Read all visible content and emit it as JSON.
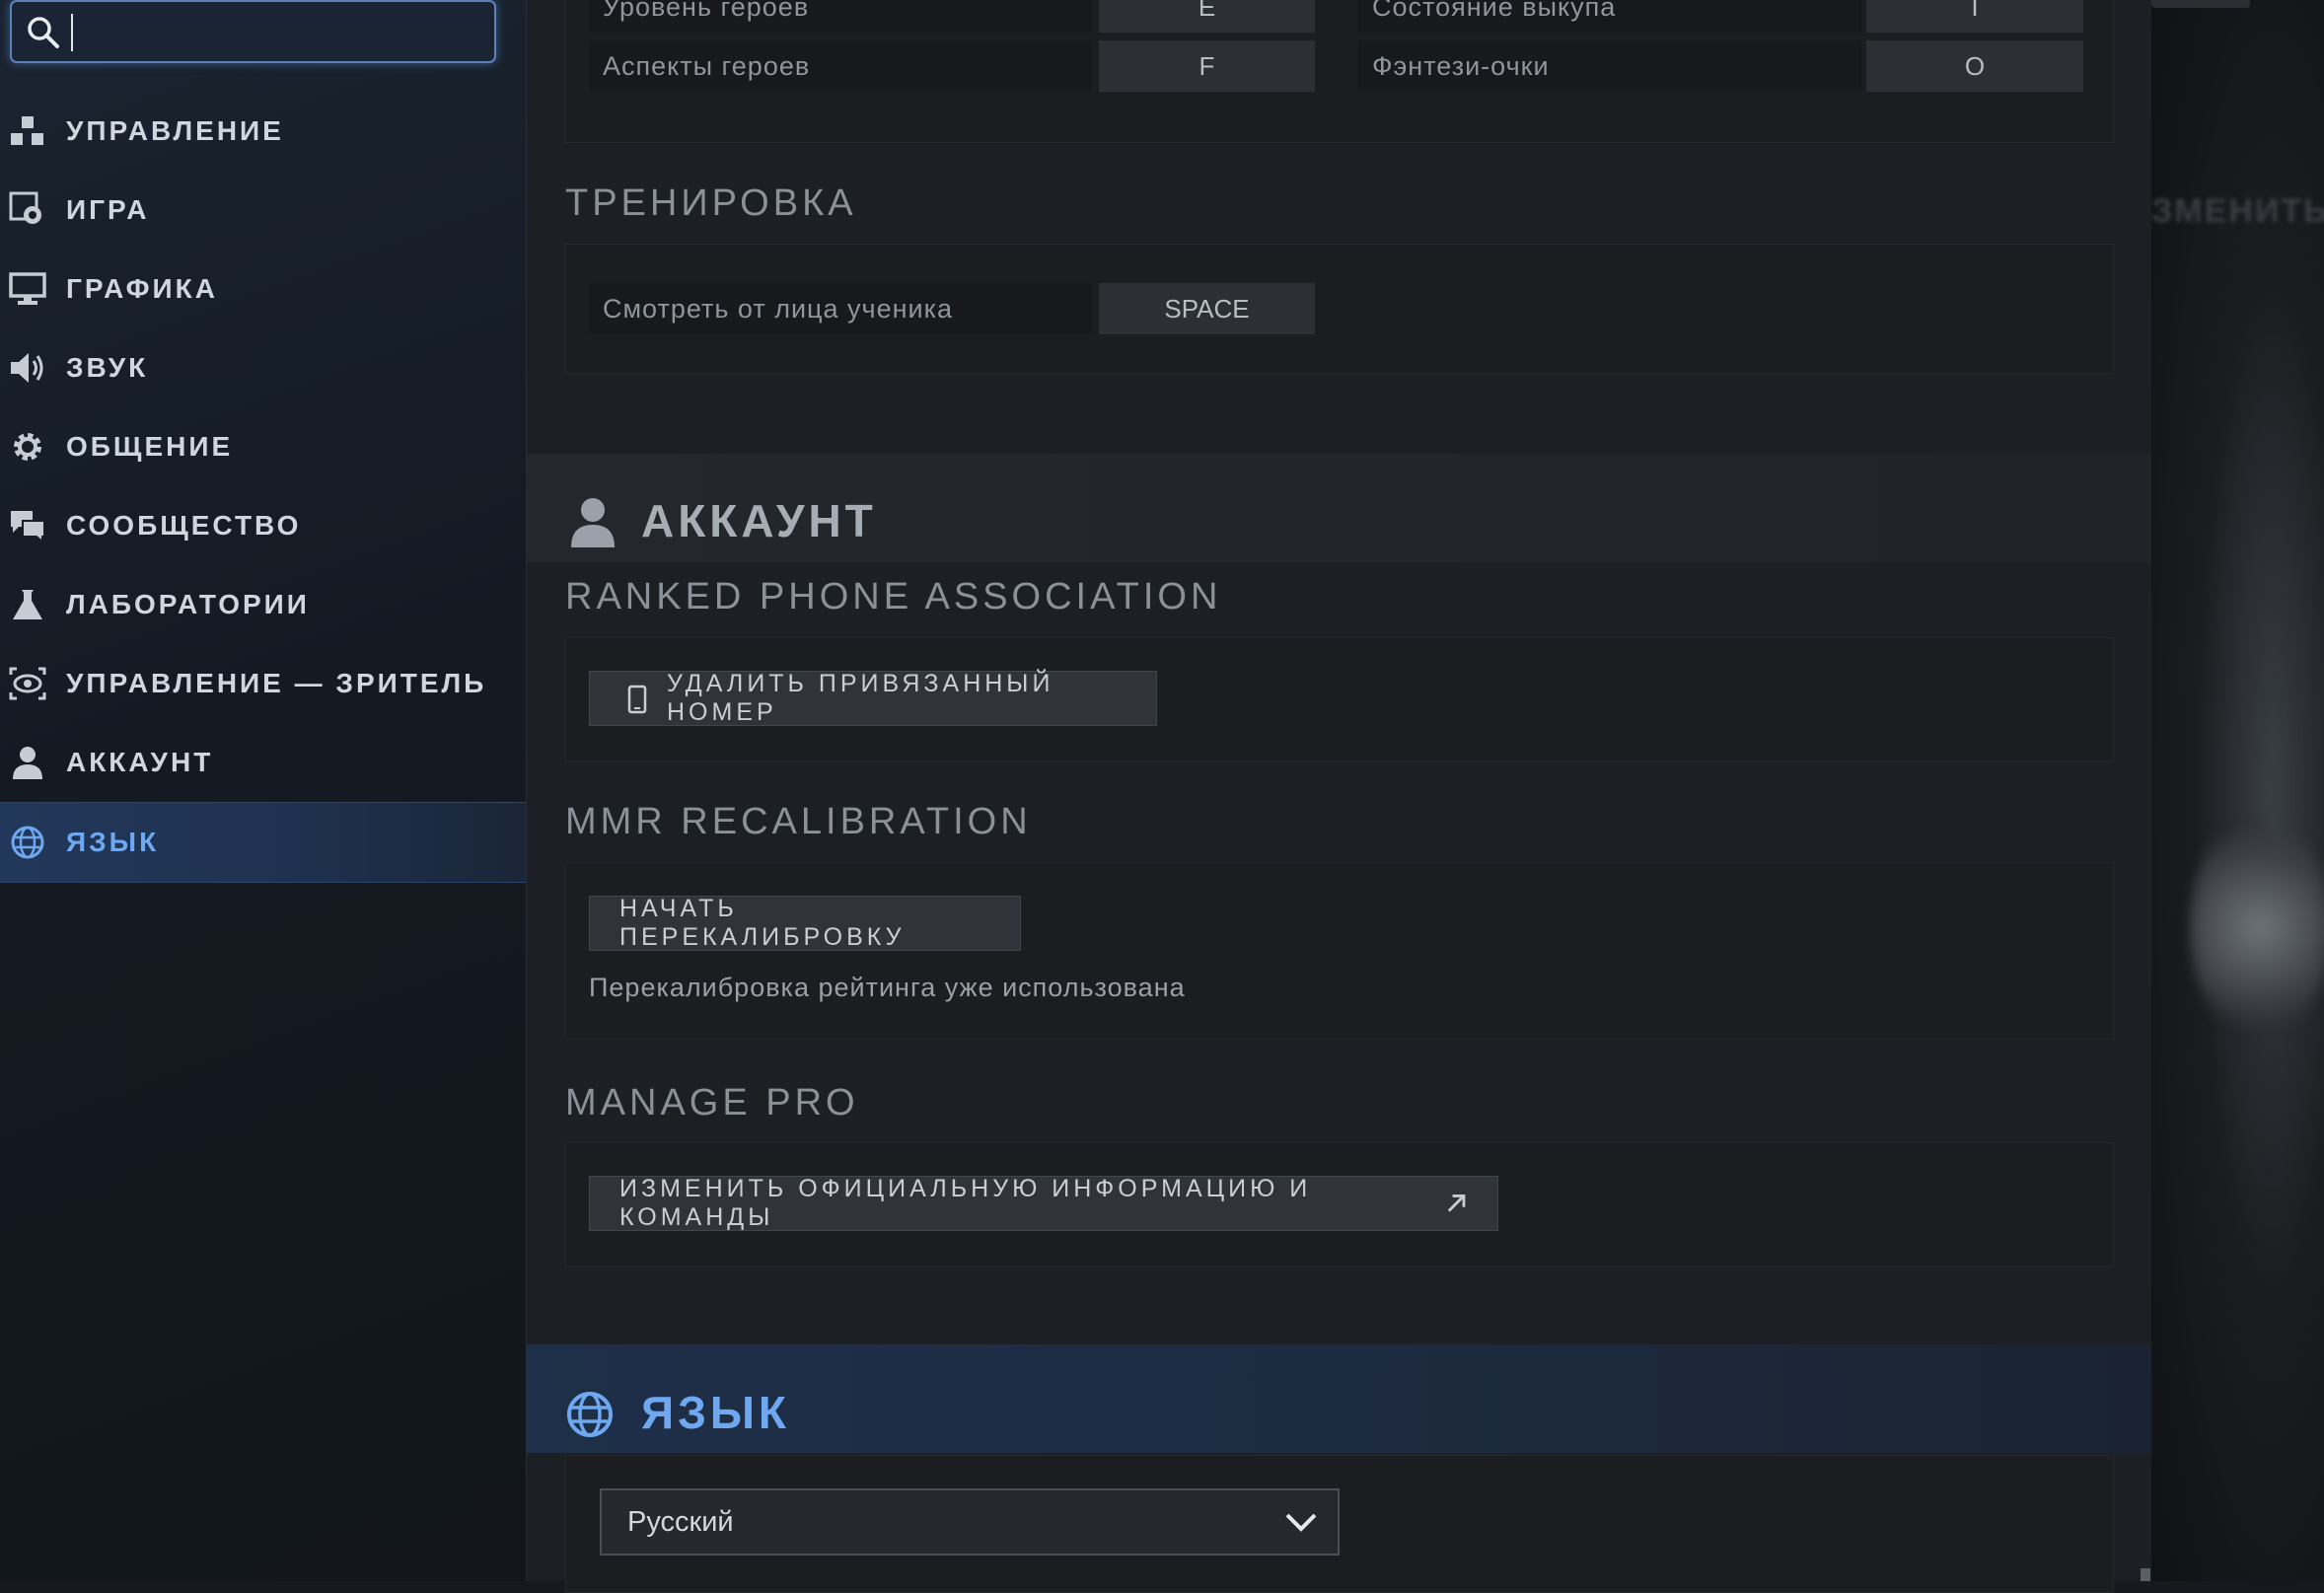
{
  "search": {
    "value": "",
    "placeholder": ""
  },
  "sidebar": {
    "items": [
      {
        "label": "УПРАВЛЕНИЕ",
        "icon": "controls-icon",
        "active": false
      },
      {
        "label": "ИГРА",
        "icon": "game-settings-icon",
        "active": false
      },
      {
        "label": "ГРАФИКА",
        "icon": "monitor-icon",
        "active": false
      },
      {
        "label": "ЗВУК",
        "icon": "speaker-icon",
        "active": false
      },
      {
        "label": "ОБЩЕНИЕ",
        "icon": "gear-icon",
        "active": false
      },
      {
        "label": "СООБЩЕСТВО",
        "icon": "chat-bubbles-icon",
        "active": false
      },
      {
        "label": "ЛАБОРАТОРИИ",
        "icon": "flask-icon",
        "active": false
      },
      {
        "label": "УПРАВЛЕНИЕ — ЗРИТЕЛЬ",
        "icon": "eye-icon",
        "active": false
      },
      {
        "label": "АККАУНТ",
        "icon": "user-icon",
        "active": false
      },
      {
        "label": "ЯЗЫК",
        "icon": "globe-icon",
        "active": true
      }
    ]
  },
  "hotkeys": {
    "rows": [
      {
        "left_label": "Уровень героев",
        "left_key": "E",
        "right_label": "Состояние выкупа",
        "right_key": "I"
      },
      {
        "left_label": "Аспекты героев",
        "left_key": "F",
        "right_label": "Фэнтези-очки",
        "right_key": "O"
      }
    ]
  },
  "training": {
    "title": "ТРЕНИРОВКА",
    "row_label": "Смотреть от лица ученика",
    "row_key": "SPACE"
  },
  "account": {
    "title": "АККАУНТ",
    "phone": {
      "title": "RANKED PHONE ASSOCIATION",
      "button": "УДАЛИТЬ ПРИВЯЗАННЫЙ НОМЕР"
    },
    "mmr": {
      "title": "MMR RECALIBRATION",
      "button": "НАЧАТЬ ПЕРЕКАЛИБРОВКУ",
      "note": "Перекалибровка рейтинга уже использована"
    },
    "pro": {
      "title": "MANAGE PRO",
      "button": "ИЗМЕНИТЬ ОФИЦИАЛЬНУЮ ИНФОРМАЦИЮ И КОМАНДЫ"
    }
  },
  "language": {
    "title": "ЯЗЫК",
    "selected": "Русский"
  },
  "right_panel": {
    "blurred_text": "ЗМЕНИТЬ"
  },
  "colors": {
    "accent_blue": "#6ea8f0",
    "section_grey": "#8a9198",
    "sidebar_text": "#cfd6dd"
  }
}
